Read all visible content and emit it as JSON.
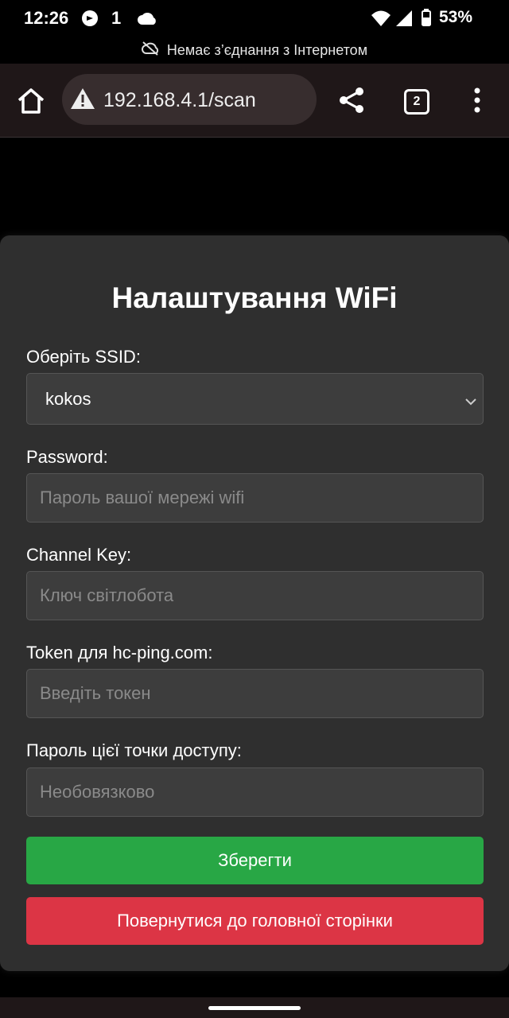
{
  "status_bar": {
    "time": "12:26",
    "notif_count": "1",
    "battery": "53%"
  },
  "offline_banner": {
    "text": "Немає з’єднання з Інтернетом"
  },
  "browser": {
    "url": "192.168.4.1/scan",
    "tab_count": "2"
  },
  "form": {
    "title": "Налаштування WiFi",
    "ssid_label": "Оберіть SSID:",
    "ssid_value": "kokos",
    "password_label": "Password:",
    "password_placeholder": "Пароль вашої мережі wifi",
    "channel_label": "Channel Key:",
    "channel_placeholder": "Ключ світлобота",
    "token_label": "Token для hc-ping.com:",
    "token_placeholder": "Введіть токен",
    "ap_password_label": "Пароль цієї точки доступу:",
    "ap_password_placeholder": "Необовязково",
    "save_label": "Зберегти",
    "back_label": "Повернутися до головної сторінки"
  },
  "colors": {
    "save": "#28a745",
    "back": "#dc3545",
    "card": "#2f2f2f",
    "field": "#3d3d3d"
  },
  "icons": [
    "home-icon",
    "warning-icon",
    "share-icon",
    "tabs-icon",
    "more-vert-icon",
    "cloud-off-icon",
    "chevron-down-icon",
    "wifi-icon",
    "signal-icon",
    "battery-icon"
  ]
}
